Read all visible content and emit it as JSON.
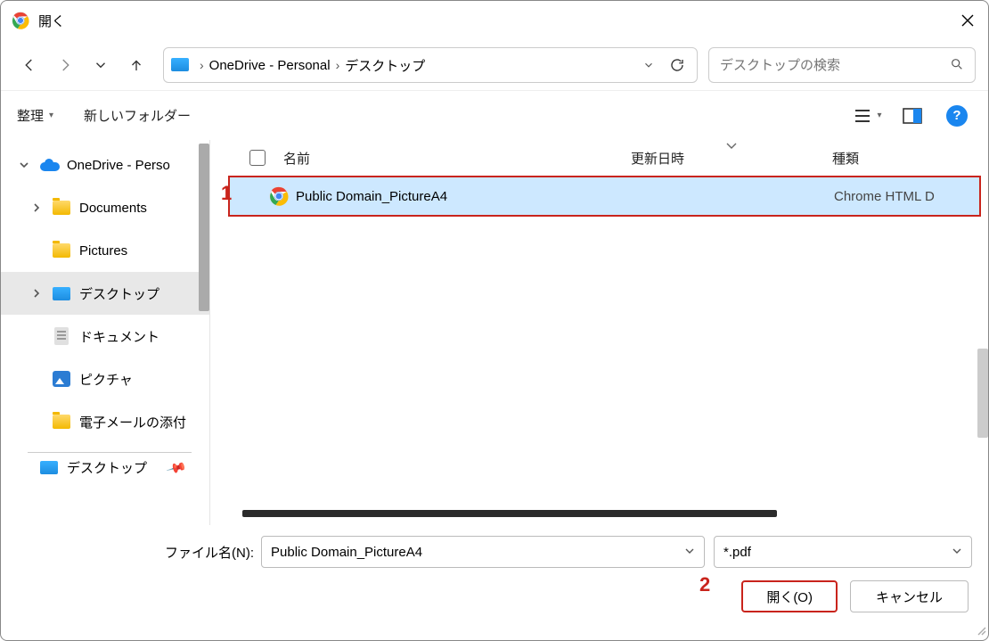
{
  "title": "開く",
  "breadcrumb": {
    "item1": "OneDrive - Personal",
    "item2": "デスクトップ"
  },
  "search": {
    "placeholder": "デスクトップの検索"
  },
  "toolbar": {
    "organize": "整理",
    "new_folder": "新しいフォルダー"
  },
  "tree": {
    "onedrive": "OneDrive - Perso",
    "documents": "Documents",
    "pictures": "Pictures",
    "desktop": "デスクトップ",
    "documents_jp": "ドキュメント",
    "pictures_jp": "ピクチャ",
    "email": "電子メールの添付",
    "pinned_desktop": "デスクトップ"
  },
  "headers": {
    "name": "名前",
    "date": "更新日時",
    "type": "種類"
  },
  "file": {
    "name": "Public Domain_PictureA4",
    "type": "Chrome HTML D"
  },
  "bottom": {
    "filename_label": "ファイル名(N):",
    "filename_value": "Public Domain_PictureA4",
    "filter": "*.pdf",
    "open": "開く(O)",
    "cancel": "キャンセル"
  },
  "annotations": {
    "a1": "1",
    "a2": "2"
  }
}
